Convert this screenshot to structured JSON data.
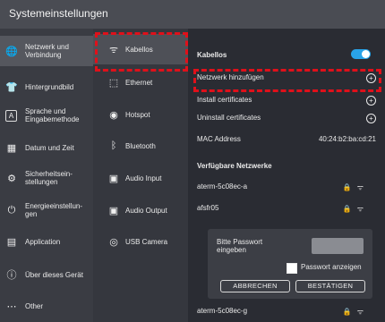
{
  "window": {
    "title": "Systemeinstellungen"
  },
  "sidebar": {
    "items": [
      {
        "label": "Netzwerk und Verbindung",
        "icon": "globe-icon"
      },
      {
        "label": "Hintergrundbild",
        "icon": "shirt-icon"
      },
      {
        "label": "Sprache und Eingabemethode",
        "icon": "keyboard-icon"
      },
      {
        "label": "Datum und Zeit",
        "icon": "calendar-icon"
      },
      {
        "label": "Sicherheitsein-stellungen",
        "icon": "shield-icon"
      },
      {
        "label": "Energieeinstellun-gen",
        "icon": "power-icon"
      },
      {
        "label": "Application",
        "icon": "grid-icon"
      },
      {
        "label": "Über dieses Gerät",
        "icon": "info-icon"
      },
      {
        "label": "Other",
        "icon": "more-icon"
      }
    ]
  },
  "subnav": {
    "items": [
      {
        "label": "Kabellos",
        "icon": "wifi-icon"
      },
      {
        "label": "Ethernet",
        "icon": "ethernet-icon"
      },
      {
        "label": "Hotspot",
        "icon": "hotspot-icon"
      },
      {
        "label": "Bluetooth",
        "icon": "bluetooth-icon"
      },
      {
        "label": "Audio Input",
        "icon": "audio-input-icon"
      },
      {
        "label": "Audio Output",
        "icon": "audio-output-icon"
      },
      {
        "label": "USB Camera",
        "icon": "camera-icon"
      }
    ]
  },
  "wireless": {
    "header": "Kabellos",
    "enabled": true,
    "add_network": "Netzwerk hinzufügen",
    "install_certificates": "Install certificates",
    "uninstall_certificates": "Uninstall certificates",
    "mac_label": "MAC Address",
    "mac_value": "40:24:b2:ba:cd:21",
    "available_header": "Verfügbare Netzwerke",
    "networks": [
      {
        "ssid": "aterm-5c08ec-a"
      },
      {
        "ssid": "afsfr05"
      },
      {
        "ssid": "aterm-5c08ec-g"
      }
    ]
  },
  "password_dialog": {
    "prompt": "Bitte Passwort eingeben",
    "show_password": "Passwort anzeigen",
    "cancel": "ABBRECHEN",
    "confirm": "BESTÄTIGEN"
  },
  "colors": {
    "accent": "#29a3e8",
    "highlight": "#e0101a"
  }
}
